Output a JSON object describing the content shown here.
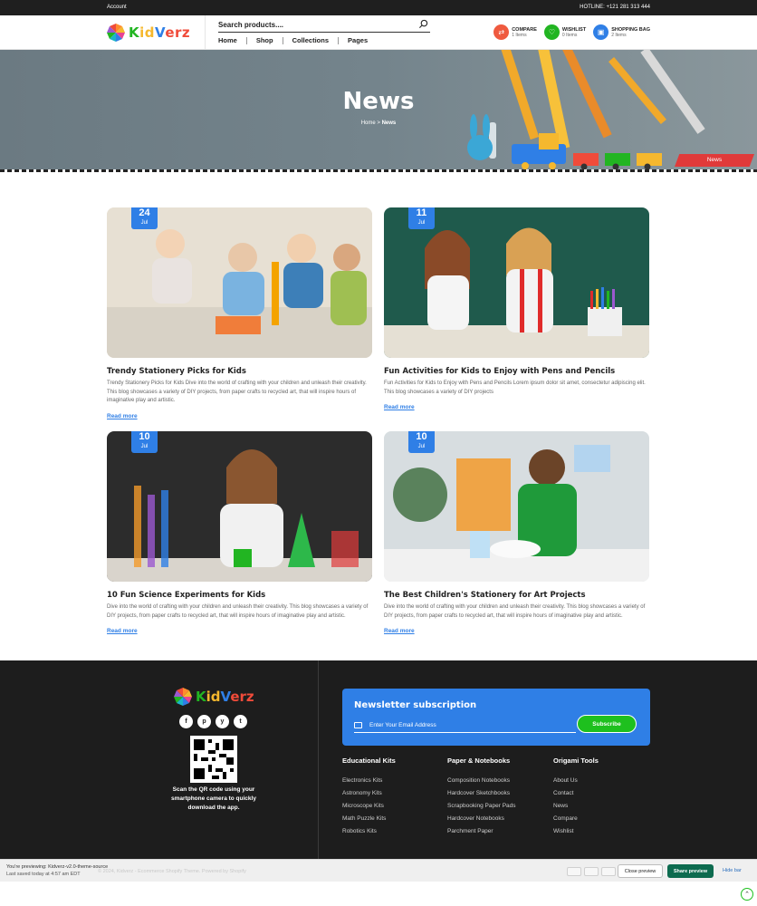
{
  "topbar": {
    "account": "Account",
    "hotline": "HOTLINE: +121 281 313 444"
  },
  "brand": {
    "name": "KidVerz"
  },
  "search": {
    "placeholder": "Search products...."
  },
  "nav": [
    "Home",
    "Shop",
    "Collections",
    "Pages"
  ],
  "header_icons": [
    {
      "label": "COMPARE",
      "sub": "1 Items",
      "icon": "compare-icon",
      "color": "#ef5a3f"
    },
    {
      "label": "WISHLIST",
      "sub": "0 Items",
      "icon": "heart-icon",
      "color": "#22b522"
    },
    {
      "label": "SHOPPING BAG",
      "sub": "2 Items",
      "icon": "bag-icon",
      "color": "#2f7fe6"
    }
  ],
  "hero": {
    "title": "News",
    "crumb_home": "Home",
    "crumb_sep": ">",
    "crumb_current": "News",
    "ribbon": "News"
  },
  "posts": [
    {
      "day": "24",
      "month": "Jul",
      "title": "Trendy Stationery Picks for Kids",
      "excerpt": "Trendy Stationery Picks for Kids Dive into the world of crafting with your children and unleash their creativity. This blog showcases a variety of DIY projects, from paper crafts to recycled art, that will inspire hours of imaginative play and artistic.",
      "more": "Read more"
    },
    {
      "day": "11",
      "month": "Jul",
      "title": "Fun Activities for Kids to Enjoy with Pens and Pencils",
      "excerpt": "Fun Activities for Kids to Enjoy with Pens and Pencils Lorem ipsum dolor sit amet, consectetur adipiscing elit. This blog showcases a variety of DIY projects",
      "more": "Read more"
    },
    {
      "day": "10",
      "month": "Jul",
      "title": "10 Fun Science Experiments for Kids",
      "excerpt": "Dive into the world of crafting with your children and unleash their creativity. This blog showcases a variety of DIY projects, from paper crafts to recycled art, that will inspire hours of imaginative play and artistic.",
      "more": "Read more"
    },
    {
      "day": "10",
      "month": "Jul",
      "title": "The Best Children's Stationery for Art Projects",
      "excerpt": "Dive into the world of crafting with your children and unleash their creativity. This blog showcases a variety of DIY projects, from paper crafts to recycled art, that will inspire hours of imaginative play and artistic.",
      "more": "Read more"
    }
  ],
  "footer": {
    "social": [
      "f",
      "p",
      "y",
      "t"
    ],
    "scan_text": "Scan the QR code using your smartphone camera to quickly download the app.",
    "newsletter": {
      "title": "Newsletter subscription",
      "placeholder": "Enter Your Email Address",
      "button": "Subscribe"
    },
    "columns": [
      {
        "title": "Educational Kits",
        "items": [
          "Electronics Kits",
          "Astronomy Kits",
          "Microscope Kits",
          "Math Puzzle Kits",
          "Robotics Kits"
        ]
      },
      {
        "title": "Paper & Notebooks",
        "items": [
          "Composition Notebooks",
          "Hardcover Sketchbooks",
          "Scrapbooking Paper Pads",
          "Hardcover Notebooks",
          "Parchment Paper"
        ]
      },
      {
        "title": "Origami Tools",
        "items": [
          "About Us",
          "Contact",
          "News",
          "Compare",
          "Wishlist"
        ]
      }
    ]
  },
  "preview_bar": {
    "line1": "You're previewing: Kidverz-v2.0-theme-source",
    "line2": "Last saved today at 4:57 am EDT",
    "ghost": "© 2024, Kidverz - Ecommerce Shopify Theme. Powered by Shopify",
    "close": "Close preview",
    "share": "Share preview",
    "hide": "Hide bar"
  }
}
